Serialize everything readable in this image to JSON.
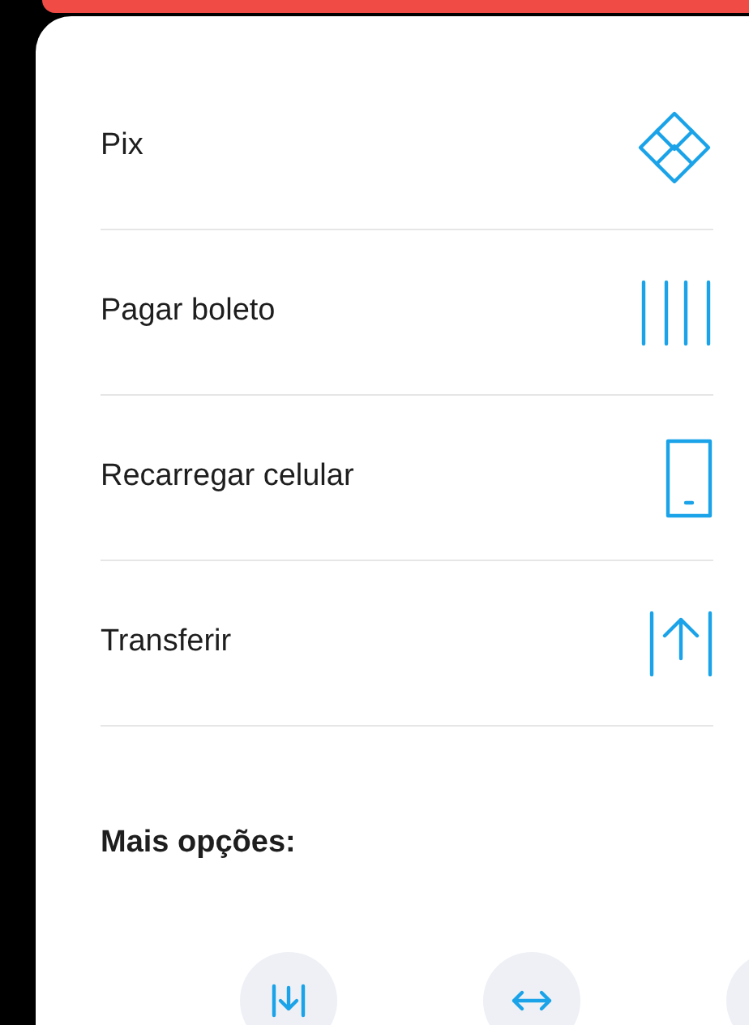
{
  "actions": [
    {
      "label": "Pix",
      "kind": "pix"
    },
    {
      "label": "Pagar boleto",
      "kind": "barcode"
    },
    {
      "label": "Recarregar celular",
      "kind": "phone"
    },
    {
      "label": "Transferir",
      "kind": "send"
    }
  ],
  "more_options": {
    "title": "Mais opções:",
    "items": [
      {
        "kind": "deposit"
      },
      {
        "kind": "swap"
      },
      {
        "kind": "other"
      }
    ]
  }
}
